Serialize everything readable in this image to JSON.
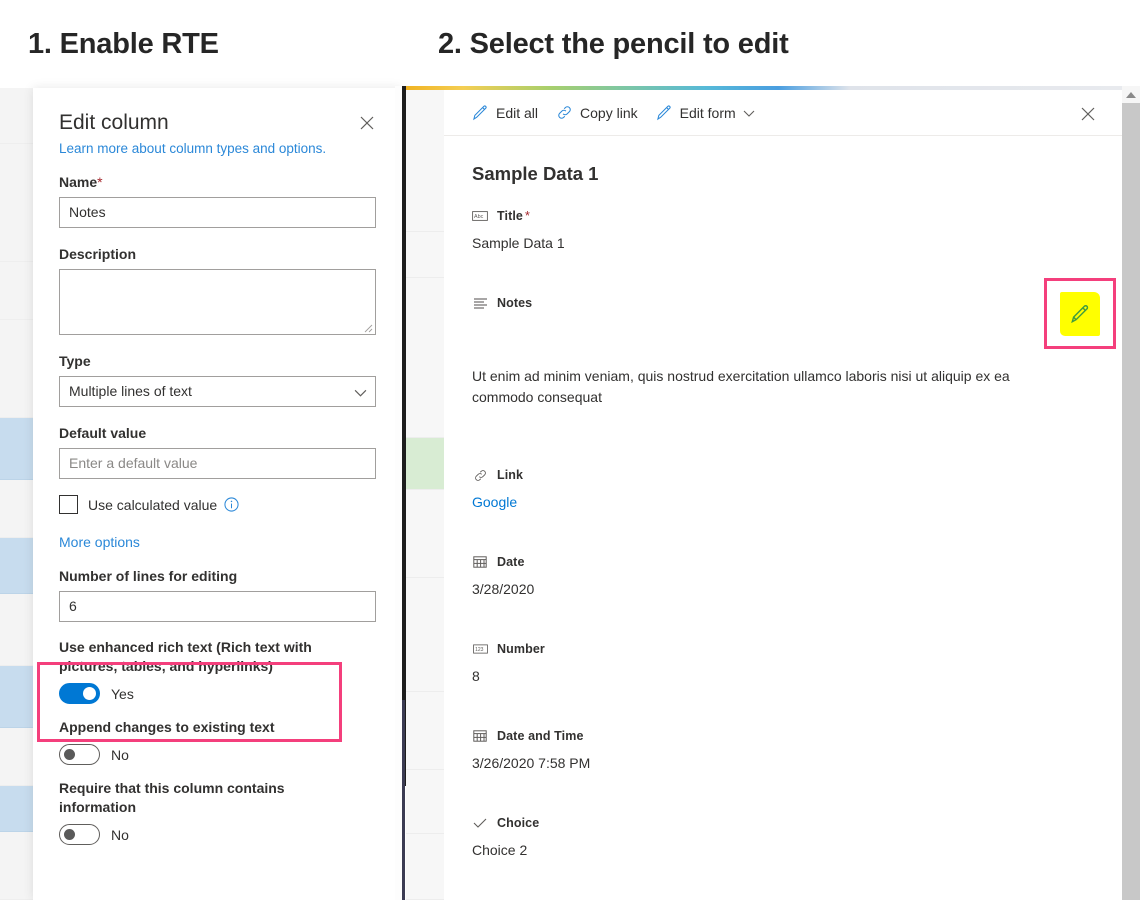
{
  "steps": {
    "step1": "1. Enable RTE",
    "step2": "2. Select the pencil to edit"
  },
  "edit_column_panel": {
    "title": "Edit column",
    "close_label": "Close",
    "learn_more": "Learn more about column types and options.",
    "name_label": "Name",
    "name_required_marker": "*",
    "name_value": "Notes",
    "description_label": "Description",
    "description_value": "",
    "type_label": "Type",
    "type_value": "Multiple lines of text",
    "default_value_label": "Default value",
    "default_value_placeholder": "Enter a default value",
    "use_calculated_value_label": "Use calculated value",
    "more_options_label": "More options",
    "lines_label": "Number of lines for editing",
    "lines_value": "6",
    "rte_label": "Use enhanced rich text (Rich text with pictures, tables, and hyperlinks)",
    "rte_state": "Yes",
    "append_label": "Append changes to existing text",
    "append_state": "No",
    "require_label": "Require that this column contains information",
    "require_state": "No"
  },
  "detail_pane": {
    "toolbar": {
      "edit_all": "Edit all",
      "copy_link": "Copy link",
      "edit_form": "Edit form",
      "close_label": "Close"
    },
    "record_title": "Sample Data 1",
    "fields": [
      {
        "name": "Title",
        "required": "*",
        "value": "Sample Data 1",
        "icon": "text-abc-icon"
      },
      {
        "name": "Notes",
        "required": "",
        "value": "Ut enim ad minim veniam, quis nostrud exercitation ullamco laboris nisi ut aliquip ex ea commodo consequat",
        "icon": "multiline-text-icon"
      },
      {
        "name": "Link",
        "required": "",
        "value": "Google",
        "icon": "link-icon"
      },
      {
        "name": "Date",
        "required": "",
        "value": "3/28/2020",
        "icon": "calendar-icon"
      },
      {
        "name": "Number",
        "required": "",
        "value": "8",
        "icon": "number-123-icon"
      },
      {
        "name": "Date and Time",
        "required": "",
        "value": "3/26/2020 7:58 PM",
        "icon": "calendar-icon"
      },
      {
        "name": "Choice",
        "required": "",
        "value": "Choice 2",
        "icon": "checkmark-icon"
      }
    ]
  },
  "annotations": {
    "callout_color": "#f43f7c",
    "highlight_color": "#ffff00",
    "pencil_color": "#3f9c3f",
    "accent_color": "#0078d4",
    "link_color": "#2b88d8"
  }
}
